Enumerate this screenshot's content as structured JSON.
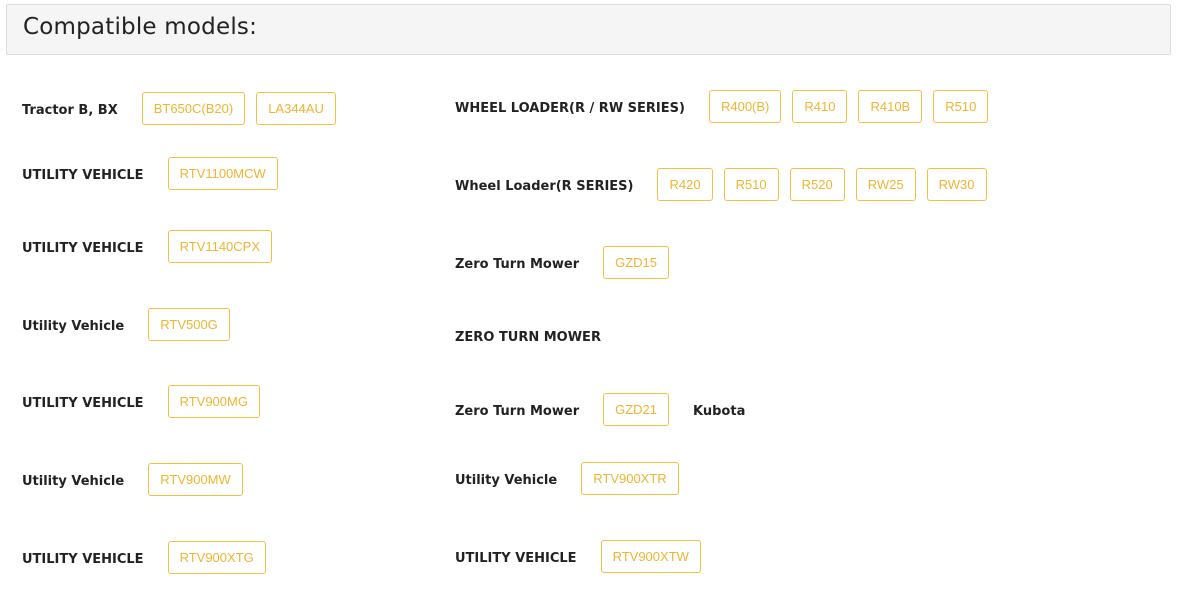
{
  "header": {
    "title": "Compatible models:"
  },
  "left": [
    {
      "label": "Tractor B, BX",
      "models": [
        "BT650C(B20)",
        "LA344AU"
      ]
    },
    {
      "label": "UTILITY VEHICLE",
      "models": [
        "RTV1100MCW"
      ]
    },
    {
      "label": "UTILITY VEHICLE",
      "models": [
        "RTV1140CPX"
      ]
    },
    {
      "label": "Utility Vehicle",
      "models": [
        "RTV500G"
      ]
    },
    {
      "label": "UTILITY VEHICLE",
      "models": [
        "RTV900MG"
      ]
    },
    {
      "label": "Utility Vehicle",
      "models": [
        "RTV900MW"
      ]
    },
    {
      "label": "UTILITY VEHICLE",
      "models": [
        "RTV900XTG"
      ]
    }
  ],
  "right": [
    {
      "label": "WHEEL LOADER(R / RW SERIES)",
      "models": [
        "R400(B)",
        "R410",
        "R410B",
        "R510"
      ]
    },
    {
      "label": "Wheel Loader(R SERIES)",
      "models": [
        "R420",
        "R510",
        "R520",
        "RW25",
        "RW30"
      ]
    },
    {
      "label": "Zero Turn Mower",
      "models": [
        "GZD15"
      ]
    },
    {
      "label": "ZERO TURN MOWER",
      "models": []
    },
    {
      "label": "Zero Turn Mower",
      "models": [
        "GZD21"
      ],
      "trailing": "Kubota"
    },
    {
      "label": "Utility Vehicle",
      "models": [
        "RTV900XTR"
      ]
    },
    {
      "label": "UTILITY VEHICLE",
      "models": [
        "RTV900XTW"
      ]
    }
  ],
  "colors": {
    "accent": "#efb531",
    "tag_border": "#f0c040",
    "text": "#222222",
    "header_bg": "#f5f5f5"
  }
}
